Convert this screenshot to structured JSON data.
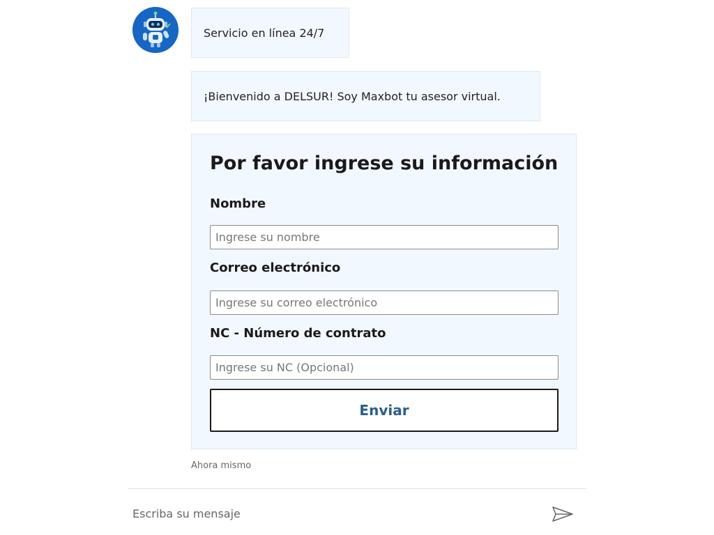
{
  "bot": {
    "avatar_icon": "robot-icon",
    "accent_color": "#1667c5"
  },
  "messages": [
    {
      "text": "Servicio en línea 24/7"
    },
    {
      "text": "¡Bienvenido a DELSUR! Soy Maxbot tu asesor virtual."
    }
  ],
  "form": {
    "title": "Por favor ingrese su información",
    "fields": [
      {
        "label": "Nombre",
        "placeholder": "Ingrese su nombre",
        "value": ""
      },
      {
        "label": "Correo electrónico",
        "placeholder": "Ingrese su correo electrónico",
        "value": ""
      },
      {
        "label": "NC - Número de contrato",
        "placeholder": "Ingrese su NC (Opcional)",
        "value": ""
      }
    ],
    "submit_label": "Enviar",
    "submit_color": "#2a5d93"
  },
  "timestamp": "Ahora mismo",
  "composer": {
    "placeholder": "Escriba su mensaje",
    "value": "",
    "send_icon": "send-icon"
  }
}
